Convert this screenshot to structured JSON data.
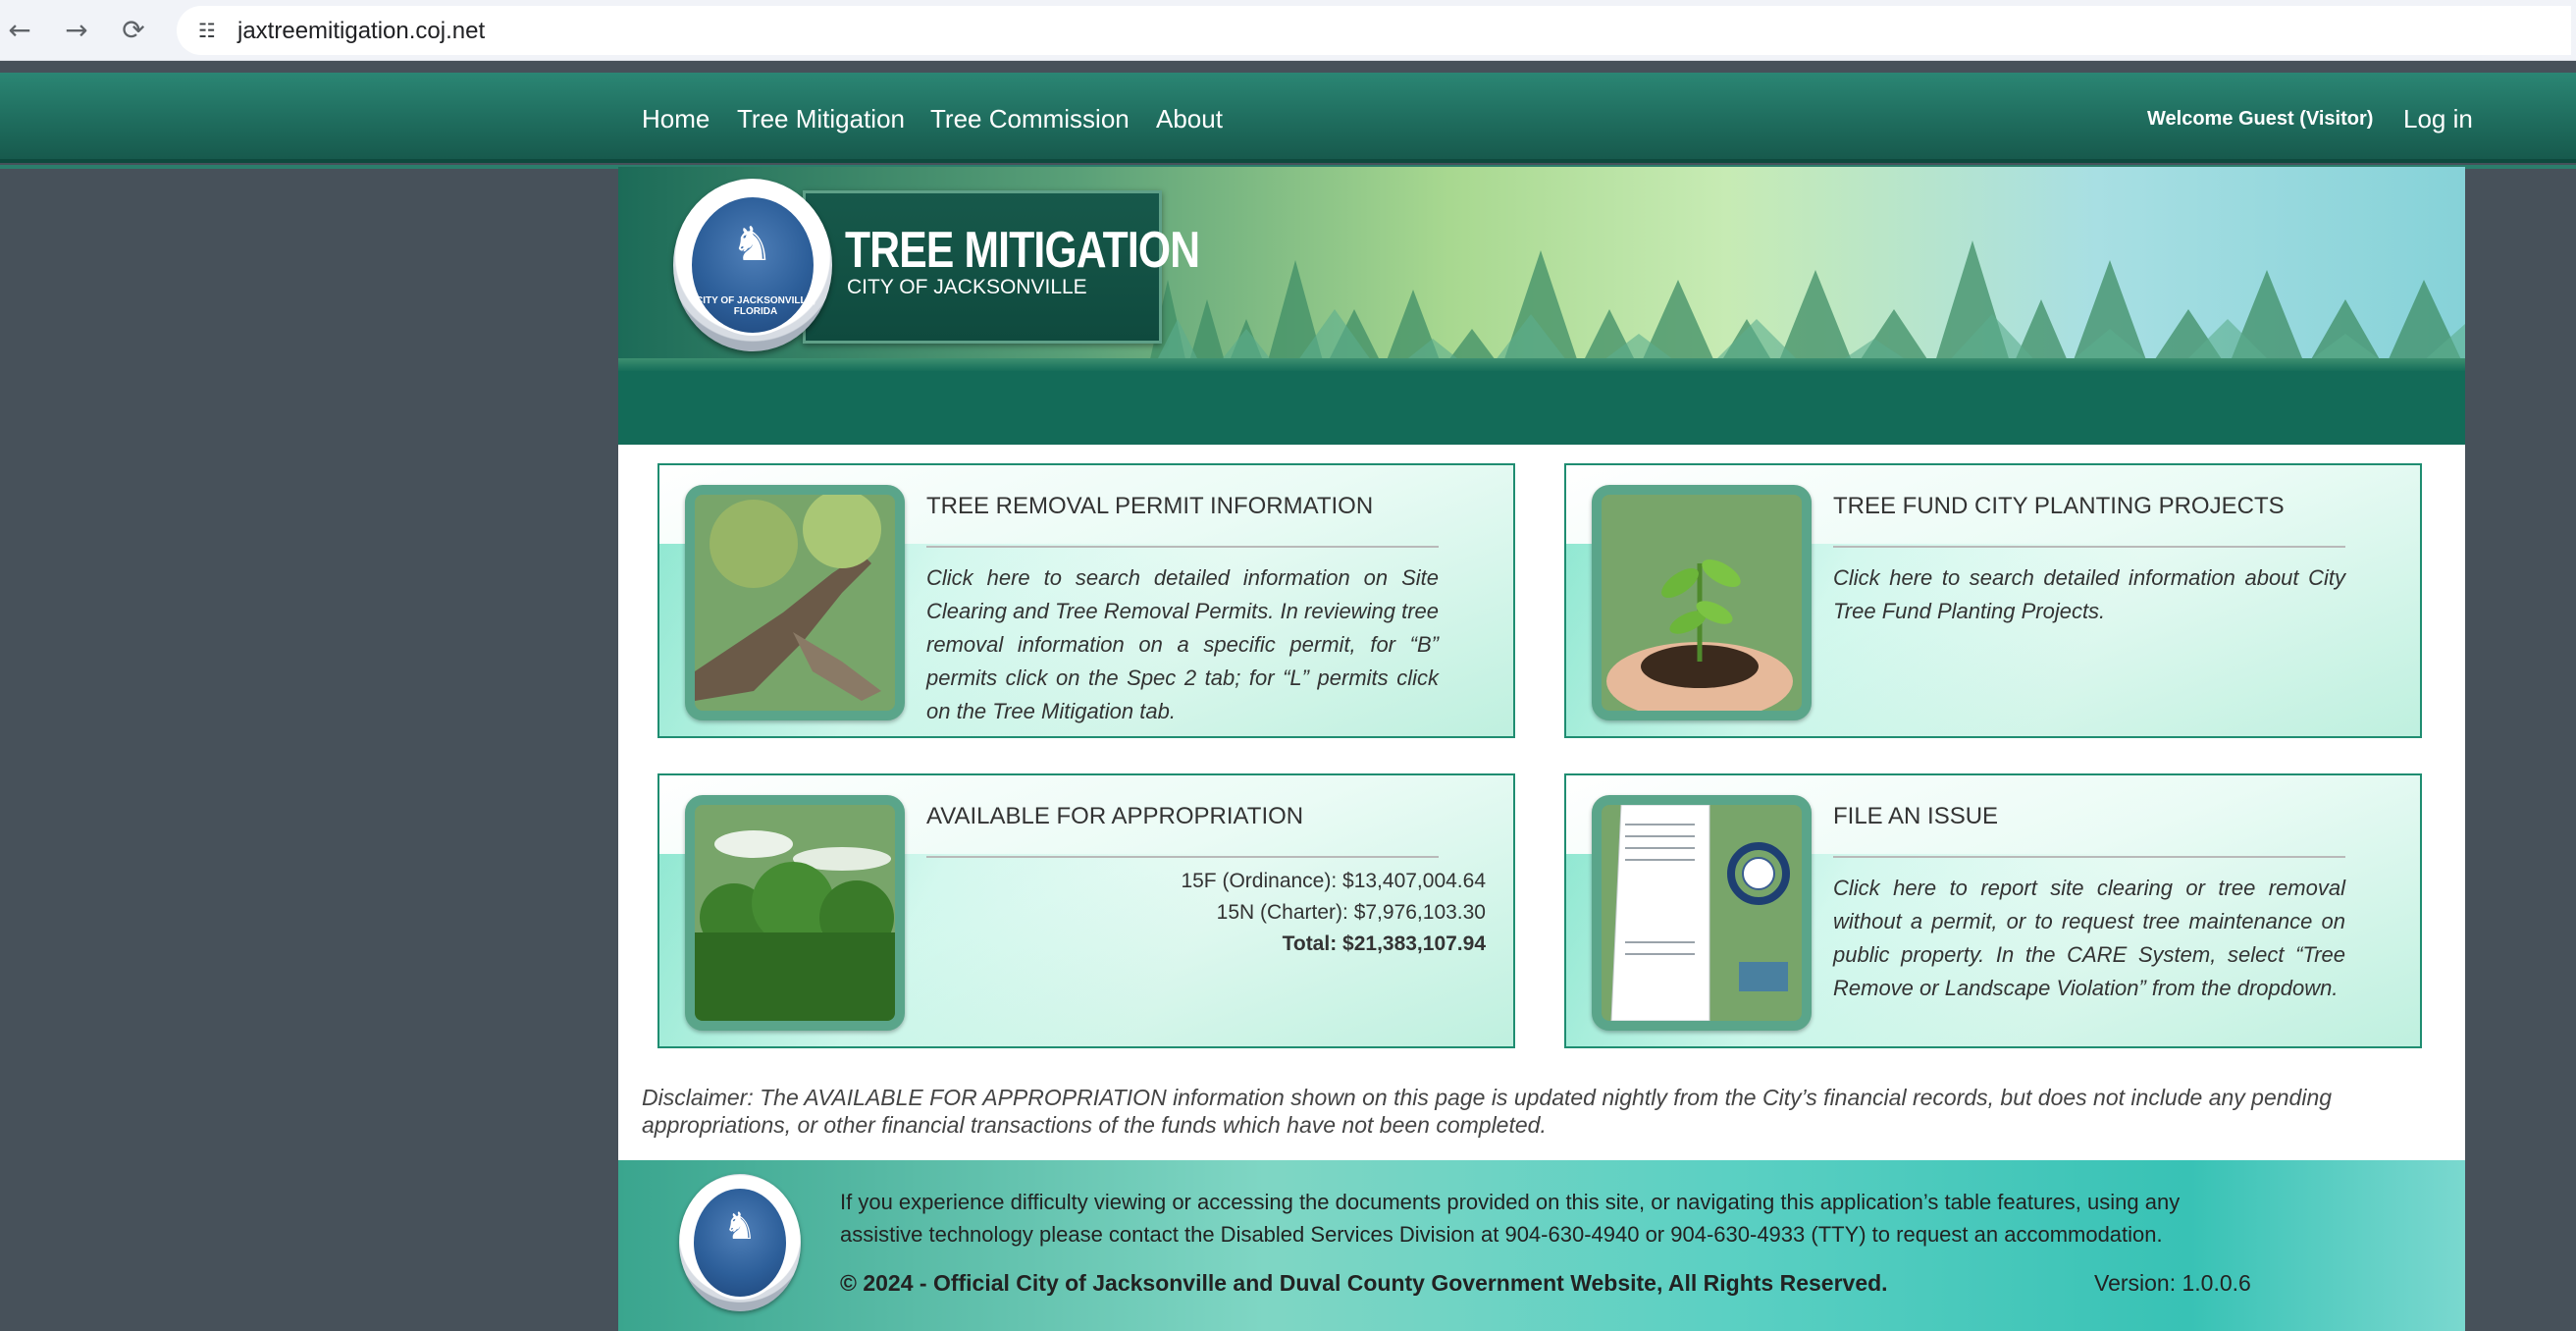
{
  "browser": {
    "url": "jaxtreemitigation.coj.net",
    "back_icon": "←",
    "forward_icon": "→",
    "reload_icon": "⟳",
    "site_info_icon": "☷"
  },
  "nav": {
    "items": [
      {
        "label": "Home"
      },
      {
        "label": "Tree Mitigation"
      },
      {
        "label": "Tree Commission"
      },
      {
        "label": "About"
      }
    ],
    "welcome": "Welcome Guest (Visitor)",
    "login": "Log in"
  },
  "banner": {
    "title": "TREE MITIGATION",
    "subtitle": "CITY OF JACKSONVILLE",
    "seal_text": "CITY OF JACKSONVILLE, FLORIDA"
  },
  "cards": [
    {
      "title": "TREE REMOVAL PERMIT INFORMATION",
      "description": "Click here to search detailed information on Site Clearing and Tree Removal Permits. In reviewing tree removal information on a specific permit, for “B” permits click on the Spec 2 tab; for “L” permits click on the Tree Mitigation tab."
    },
    {
      "title": "TREE FUND CITY PLANTING PROJECTS",
      "description": "Click here to search detailed information about City Tree Fund Planting Projects."
    },
    {
      "title": "AVAILABLE FOR APPROPRIATION",
      "line1": "15F (Ordinance): $13,407,004.64",
      "line2": "15N (Charter): $7,976,103.30",
      "total": "Total: $21,383,107.94"
    },
    {
      "title": "FILE AN ISSUE",
      "description": "Click here to report site clearing or tree removal without a permit, or to request tree maintenance on public property. In the CARE System, select “Tree Remove or Landscape Violation” from the dropdown."
    }
  ],
  "disclaimer": "Disclaimer: The AVAILABLE FOR APPROPRIATION information shown on this page is updated nightly from the City’s financial records, but does not include any pending appropriations, or other financial transactions of the funds which have not been completed.",
  "footer": {
    "notice": "If you experience difficulty viewing or accessing the documents provided on this site, or navigating this application’s table features, using any assistive technology please contact the Disabled Services Division at 904-630-4940 or 904-630-4933 (TTY) to request an accommodation.",
    "copyright": "© 2024 - Official City of Jacksonville and Duval County Government Website, All Rights Reserved.",
    "version": "Version: 1.0.0.6"
  },
  "colors": {
    "nav_bg": "#1f6d5e",
    "page_bg": "#47515a",
    "card_border": "#1f8d71",
    "banner_band": "#136b58"
  }
}
